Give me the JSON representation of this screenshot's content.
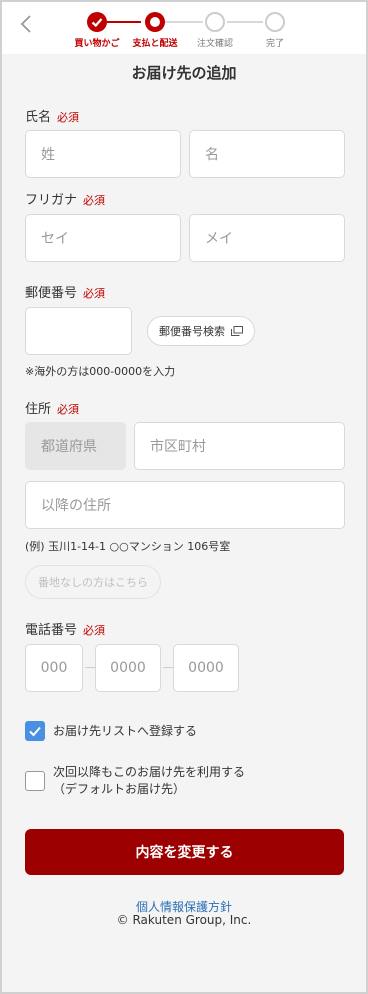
{
  "stepper": {
    "steps": [
      {
        "label": "買い物かご",
        "state": "done"
      },
      {
        "label": "支払と配送",
        "state": "current"
      },
      {
        "label": "注文確認",
        "state": "todo"
      },
      {
        "label": "完了",
        "state": "todo"
      }
    ]
  },
  "colors": {
    "accent": "#bf0000",
    "button": "#9c0000",
    "check": "#4a90e2",
    "link": "#2a6fb6"
  },
  "page_title": "お届け先の追加",
  "name_section": {
    "label": "氏名",
    "required": "必須",
    "last_placeholder": "姓",
    "first_placeholder": "名"
  },
  "kana_section": {
    "label": "フリガナ",
    "required": "必須",
    "last_placeholder": "セイ",
    "first_placeholder": "メイ"
  },
  "zip_section": {
    "label": "郵便番号",
    "required": "必須",
    "value": "",
    "search_button": "郵便番号検索",
    "note": "※海外の方は000-0000を入力"
  },
  "address_section": {
    "label": "住所",
    "required": "必須",
    "prefecture_placeholder": "都道府県",
    "city_placeholder": "市区町村",
    "street_placeholder": "以降の住所",
    "example": "(例) 玉川1-14-1 ○○マンション 106号室",
    "no_number_button": "番地なしの方はこちら"
  },
  "phone_section": {
    "label": "電話番号",
    "required": "必須",
    "part1_placeholder": "000",
    "part2_placeholder": "0000",
    "part3_placeholder": "0000"
  },
  "options": {
    "register_list": {
      "label": "お届け先リストへ登録する",
      "checked": true
    },
    "default_address": {
      "line1": "次回以降もこのお届け先を利用する",
      "line2": "（デフォルトお届け先）",
      "checked": false
    }
  },
  "submit_label": "内容を変更する",
  "footer": {
    "privacy_link": "個人情報保護方針",
    "copyright": "© Rakuten Group, Inc."
  }
}
